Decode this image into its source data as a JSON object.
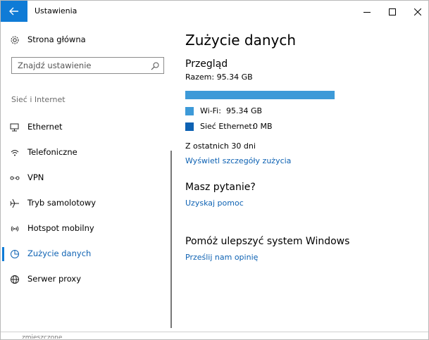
{
  "window": {
    "title": "Ustawienia",
    "back_icon": "arrow-left-icon",
    "accent_color": "#0f7bd6"
  },
  "sidebar": {
    "home_label": "Strona główna",
    "search_placeholder": "Znajdź ustawienie",
    "section_label": "Sieć i Internet",
    "items": [
      {
        "label": "Ethernet",
        "icon": "monitor-network-icon"
      },
      {
        "label": "Telefoniczne",
        "icon": "dialup-icon"
      },
      {
        "label": "VPN",
        "icon": "vpn-icon"
      },
      {
        "label": "Tryb samolotowy",
        "icon": "airplane-icon"
      },
      {
        "label": "Hotspot mobilny",
        "icon": "hotspot-icon"
      },
      {
        "label": "Zużycie danych",
        "icon": "data-usage-icon",
        "active": true
      },
      {
        "label": "Serwer proxy",
        "icon": "globe-icon"
      }
    ]
  },
  "main": {
    "title": "Zużycie danych",
    "overview_heading": "Przegląd",
    "total_text": "Razem: 95.34 GB",
    "usage": {
      "wifi_fraction": 1.0,
      "bar_color": "#3d9ad8",
      "wifi_label": "Wi-Fi:",
      "wifi_value": "95.34 GB",
      "wifi_color": "#3d9ad8",
      "ethernet_label": "Sieć Ethernet:",
      "ethernet_value": "0 MB",
      "ethernet_color": "#0e62b3"
    },
    "period_text": "Z ostatnich 30 dni",
    "details_link": "Wyświetl szczegóły zużycia",
    "question_heading": "Masz pytanie?",
    "help_link": "Uzyskaj pomoc",
    "improve_heading": "Pomóż ulepszyć system Windows",
    "feedback_link": "Prześlij nam opinię"
  },
  "taskbar": {
    "partial_text": "zmieszczone"
  }
}
